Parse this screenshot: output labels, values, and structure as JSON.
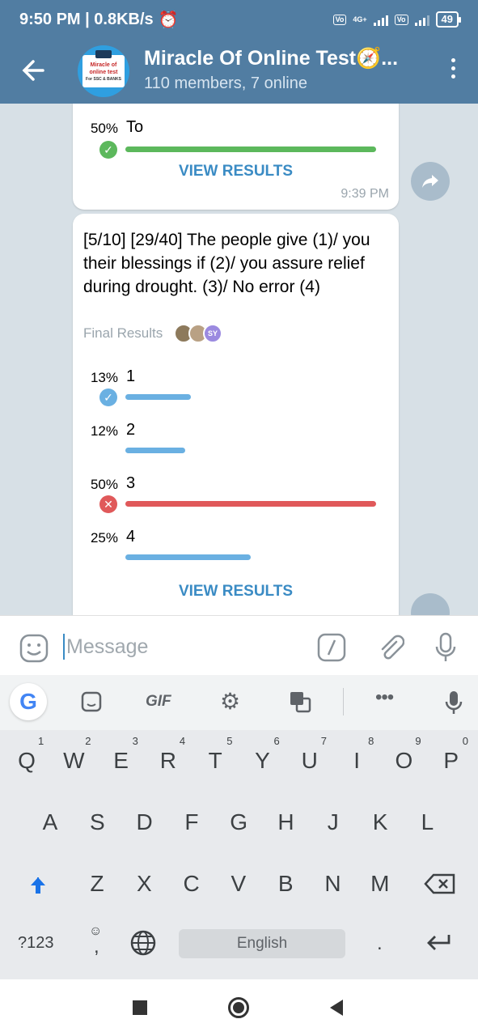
{
  "status_bar": {
    "time_speed": "9:50 PM | 0.8KB/s",
    "net_gen": "4G+",
    "lte": "Vo\nLTE",
    "battery": "49"
  },
  "header": {
    "title": "Miracle Of Online Test🧭...",
    "subtitle": "110 members, 7 online",
    "avatar_text": "Miracle of online test",
    "avatar_tag": "For SSC & BANKS"
  },
  "poll1": {
    "options": [
      {
        "pct": "50%",
        "text": "To",
        "fraction": 1.0,
        "state": "correct"
      }
    ],
    "view_results": "VIEW RESULTS",
    "time": "9:39 PM"
  },
  "poll2": {
    "question": "[5/10] [29/40] The people give (1)/ you their blessings if (2)/ you assure relief during drought. (3)/ No error (4)",
    "final_label": "Final Results",
    "voter_badge": "SY",
    "options": [
      {
        "pct": "13%",
        "text": "1",
        "fraction": 0.26,
        "state": "chosen"
      },
      {
        "pct": "12%",
        "text": "2",
        "fraction": 0.24,
        "state": "none"
      },
      {
        "pct": "50%",
        "text": "3",
        "fraction": 1.0,
        "state": "wrong"
      },
      {
        "pct": "25%",
        "text": "4",
        "fraction": 0.5,
        "state": "none"
      }
    ],
    "view_results": "VIEW RESULTS"
  },
  "input": {
    "placeholder": "Message"
  },
  "keyboard": {
    "toolbar": [
      "G",
      "sticker-icon",
      "GIF",
      "gear-icon",
      "translate-icon",
      "more-icon",
      "mic-icon"
    ],
    "row1": [
      "Q",
      "W",
      "E",
      "R",
      "T",
      "Y",
      "U",
      "I",
      "O",
      "P"
    ],
    "row1_hints": [
      "1",
      "2",
      "3",
      "4",
      "5",
      "6",
      "7",
      "8",
      "9",
      "0"
    ],
    "row2": [
      "A",
      "S",
      "D",
      "F",
      "G",
      "H",
      "J",
      "K",
      "L"
    ],
    "row3": [
      "Z",
      "X",
      "C",
      "V",
      "B",
      "N",
      "M"
    ],
    "sym": "?123",
    "comma": ",",
    "space": "English",
    "period": "."
  },
  "colors": {
    "header": "#517da2",
    "green": "#5cb85c",
    "blue": "#6ab0e2",
    "red": "#e0595a",
    "link": "#3a8bc4"
  }
}
